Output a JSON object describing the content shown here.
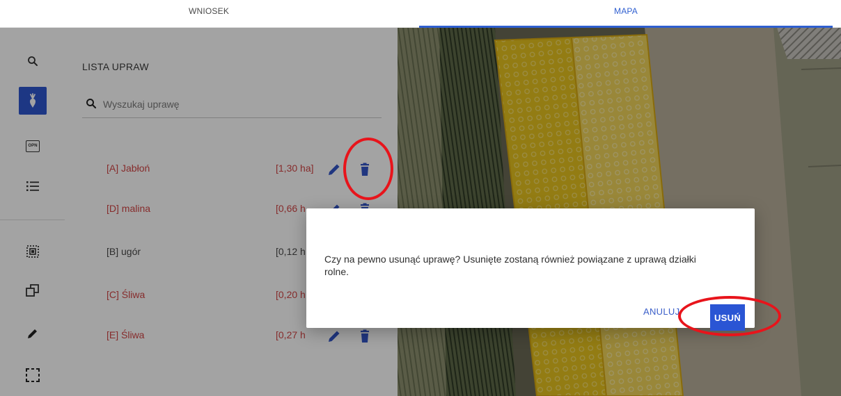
{
  "tabs": [
    {
      "label": "WNIOSEK",
      "active": false
    },
    {
      "label": "MAPA",
      "active": true
    }
  ],
  "rail": {
    "icons": [
      "search-icon",
      "crop-plant-icon",
      "opn-icon",
      "list-icon",
      "select-area-icon",
      "layers-copy-icon",
      "pencil-icon",
      "dashed-rectangle-icon"
    ],
    "opn_label": "OPN"
  },
  "panel": {
    "title": "LISTA UPRAW",
    "search_placeholder": "Wyszukaj uprawę",
    "crops": [
      {
        "name": "[A] Jabłoń",
        "area": "[1,30 ha]",
        "status": "red"
      },
      {
        "name": "[D] malina",
        "area": "[0,66 h",
        "status": "red"
      },
      {
        "name": "[B] ugór",
        "area": "[0,12 h",
        "status": "gray"
      },
      {
        "name": "[C] Śliwa",
        "area": "[0,20 h",
        "status": "red"
      },
      {
        "name": "[E] Śliwa",
        "area": "[0,27 h",
        "status": "red"
      }
    ]
  },
  "dialog": {
    "message": "Czy na pewno usunąć uprawę? Usunięte zostaną również powiązane z uprawą działki rolne.",
    "cancel_label": "ANULUJ",
    "confirm_label": "USUŃ"
  },
  "colors": {
    "accent": "#2f5fd0",
    "crop_red": "#d24545",
    "annotation": "#e8141b",
    "parcel_fill": "#e6c21e"
  }
}
